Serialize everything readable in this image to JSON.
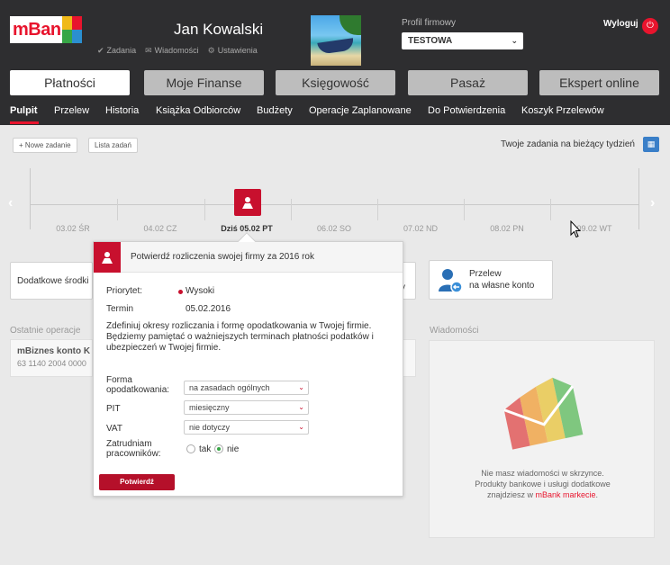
{
  "brand": {
    "name": "mBank"
  },
  "header": {
    "user_name": "Jan Kowalski",
    "links": [
      {
        "label": "Zadania",
        "icon": "check-icon"
      },
      {
        "label": "Wiadomości",
        "icon": "envelope-icon"
      },
      {
        "label": "Ustawienia",
        "icon": "gear-icon"
      }
    ],
    "profile_label": "Profil firmowy",
    "profile_value": "TESTOWA",
    "logout_label": "Wyloguj"
  },
  "main_tabs": [
    {
      "label": "Płatności",
      "active": true
    },
    {
      "label": "Moje Finanse",
      "active": false
    },
    {
      "label": "Księgowość",
      "active": false
    },
    {
      "label": "Pasaż",
      "active": false
    },
    {
      "label": "Ekspert online",
      "active": false
    }
  ],
  "sub_nav": [
    {
      "label": "Pulpit",
      "active": true
    },
    {
      "label": "Przelew"
    },
    {
      "label": "Historia"
    },
    {
      "label": "Książka Odbiorców"
    },
    {
      "label": "Budżety"
    },
    {
      "label": "Operacje Zaplanowane"
    },
    {
      "label": "Do Potwierdzenia"
    },
    {
      "label": "Koszyk Przelewów"
    }
  ],
  "toolbar": {
    "new_task": "+ Nowe zadanie",
    "task_list": "Lista zadań",
    "week_tasks": "Twoje zadania na bieżący tydzień"
  },
  "timeline": {
    "dates": [
      "03.02 ŚR",
      "04.02 CZ",
      "Dziś 05.02 PT",
      "06.02 SO",
      "07.02 ND",
      "08.02 PN",
      "09.02 WT"
    ],
    "today_index": 2
  },
  "cards": {
    "dodatkowe": "Dodatkowe środki",
    "hidden_right": "y",
    "przelew_title": "Przelew",
    "przelew_sub": "na własne konto"
  },
  "recent": {
    "label": "Ostatnie operacje",
    "name": "mBiznes konto K",
    "account": "63 1140 2004 0000"
  },
  "messages": {
    "label": "Wiadomości",
    "line1": "Nie masz wiadomości w skrzynce.",
    "line2": "Produkty bankowe i usługi dodatkowe",
    "line3_prefix": "znajdziesz w ",
    "line3_link": "mBank markecie",
    "line3_suffix": "."
  },
  "popup": {
    "title": "Potwierdź rozliczenia swojej firmy za 2016 rok",
    "priority_label": "Priorytet:",
    "priority_value": "Wysoki",
    "term_label": "Termin",
    "term_value": "05.02.2016",
    "description": "Zdefiniuj okresy rozliczania i formę opodatkowania w Twojej firmie. Będziemy pamiętać o ważniejszych terminach płatności podatków i ubezpieczeń w Twojej firmie.",
    "form_label_1": "Forma",
    "form_label_2": "opodatkowania:",
    "form_value": "na zasadach ogólnych",
    "pit_label": "PIT",
    "pit_value": "miesięczny",
    "vat_label": "VAT",
    "vat_value": "nie dotyczy",
    "employ_label_1": "Zatrudniam",
    "employ_label_2": "pracowników:",
    "yes_label": "tak",
    "no_label": "nie",
    "employ_selected": "nie",
    "confirm_label": "Potwierdź"
  },
  "colors": {
    "header_bg": "#2e2e30",
    "accent_red": "#c8102e",
    "radio_green": "#37a646"
  }
}
